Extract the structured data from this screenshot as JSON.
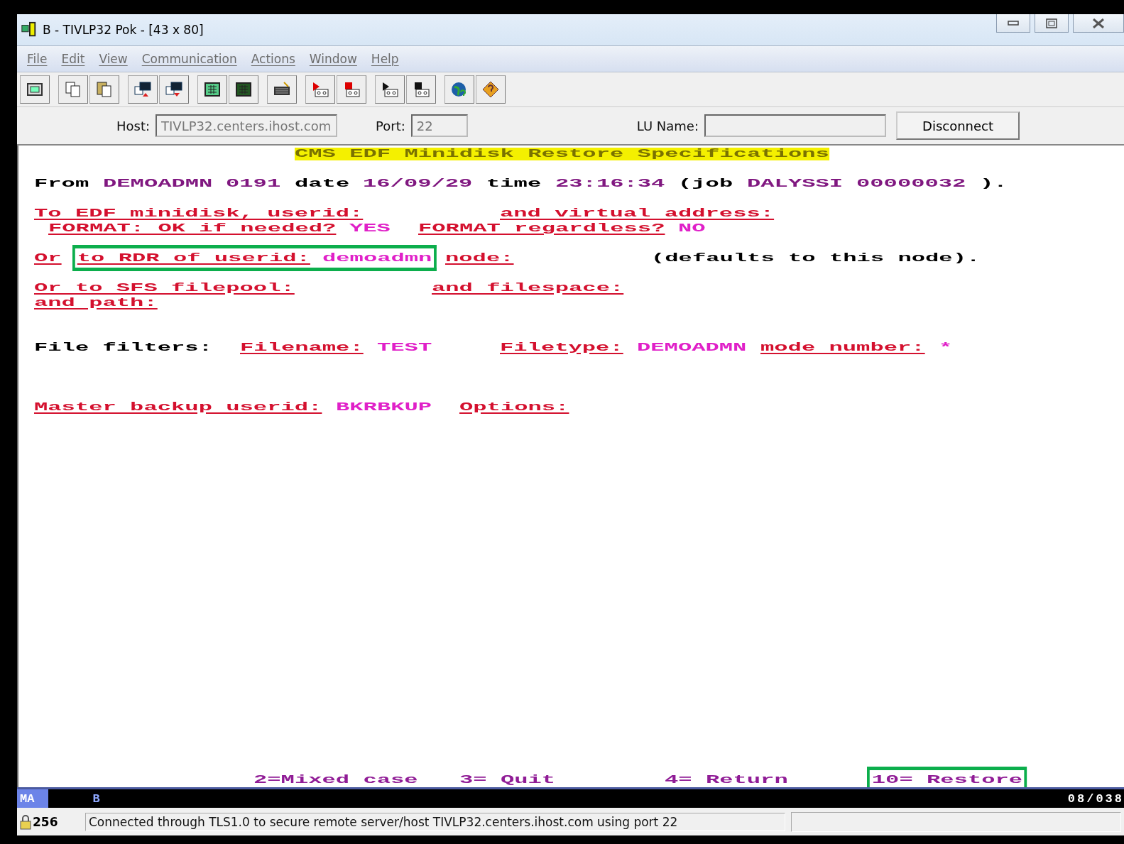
{
  "window": {
    "title": "B - TIVLP32 Pok - [43 x 80]"
  },
  "menu": [
    "File",
    "Edit",
    "View",
    "Communication",
    "Actions",
    "Window",
    "Help"
  ],
  "connection": {
    "host_label": "Host:",
    "host": "TIVLP32.centers.ihost.com",
    "port_label": "Port:",
    "port": "22",
    "lu_label": "LU Name:",
    "button": "Disconnect"
  },
  "screen": {
    "title": "CMS EDF Minidisk Restore Specifications",
    "lines": [
      {
        "segments": [
          {
            "kind": "text",
            "text": "From",
            "highlighted": false
          },
          {
            "kind": "protected",
            "text": "DEMOADMN",
            "highlighted": false
          },
          {
            "kind": "protected",
            "text": "0191",
            "highlighted": false
          },
          {
            "kind": "text",
            "text": "date",
            "highlighted": false
          },
          {
            "kind": "protected",
            "text": "16/09/29",
            "highlighted": false
          },
          {
            "kind": "text",
            "text": "time",
            "highlighted": false
          },
          {
            "kind": "protected",
            "text": "23:16:34",
            "highlighted": false
          },
          {
            "kind": "text",
            "text": "(job",
            "highlighted": false
          },
          {
            "kind": "protected",
            "text": "DALYSSI",
            "highlighted": false
          },
          {
            "kind": "protected",
            "text": "00000032",
            "highlighted": false
          },
          {
            "kind": "text",
            "text": ").",
            "highlighted": false
          }
        ]
      },
      {
        "segments": [
          {
            "kind": "label",
            "text": "To EDF minidisk, userid:",
            "highlighted": false
          },
          {
            "kind": "label",
            "text": "and virtual address:",
            "highlighted": false
          }
        ]
      },
      {
        "segments": [
          {
            "kind": "label",
            "text": "FORMAT: OK if needed?",
            "highlighted": false
          },
          {
            "kind": "input",
            "text": "YES",
            "highlighted": false
          },
          {
            "kind": "label",
            "text": "FORMAT regardless?",
            "highlighted": false
          },
          {
            "kind": "input",
            "text": "NO",
            "highlighted": false
          }
        ]
      },
      {
        "segments": [
          {
            "kind": "label",
            "text": "Or",
            "highlighted": false
          },
          {
            "kind": "label",
            "text": "to RDR of userid:",
            "highlighted": true
          },
          {
            "kind": "input",
            "text": "demoadmn",
            "highlighted": true
          },
          {
            "kind": "label",
            "text": "node:",
            "highlighted": false
          },
          {
            "kind": "text",
            "text": "(defaults to this node).",
            "highlighted": false
          }
        ]
      },
      {
        "segments": [
          {
            "kind": "label",
            "text": "Or to SFS filepool:",
            "highlighted": false
          },
          {
            "kind": "label",
            "text": "and filespace:",
            "highlighted": false
          }
        ]
      },
      {
        "segments": [
          {
            "kind": "label",
            "text": "and path:",
            "highlighted": false
          }
        ]
      },
      {
        "segments": [
          {
            "kind": "text",
            "text": "File filters:",
            "highlighted": false
          },
          {
            "kind": "label",
            "text": "Filename:",
            "highlighted": false
          },
          {
            "kind": "input",
            "text": "TEST",
            "highlighted": false
          },
          {
            "kind": "label",
            "text": "Filetype:",
            "highlighted": false
          },
          {
            "kind": "input",
            "text": "DEMOADMN",
            "highlighted": false
          },
          {
            "kind": "label",
            "text": "mode number:",
            "highlighted": false
          },
          {
            "kind": "input",
            "text": "*",
            "highlighted": false
          }
        ]
      },
      {
        "segments": [
          {
            "kind": "label",
            "text": "Master backup userid:",
            "highlighted": false
          },
          {
            "kind": "input",
            "text": "BKRBKUP",
            "highlighted": false
          },
          {
            "kind": "label",
            "text": "Options:",
            "highlighted": false
          }
        ]
      }
    ],
    "function_keys": [
      {
        "text": "2=Mixed case",
        "highlighted": false
      },
      {
        "text": "3= Quit",
        "highlighted": false
      },
      {
        "text": "4= Return",
        "highlighted": false
      },
      {
        "text": "10= Restore",
        "highlighted": true
      }
    ]
  },
  "oia": {
    "mode": "MA",
    "session": "B",
    "cursor": "08/038"
  },
  "status_bar": {
    "count": "256",
    "message": "Connected through TLS1.0 to secure remote server/host TIVLP32.centers.ihost.com using port 22"
  }
}
